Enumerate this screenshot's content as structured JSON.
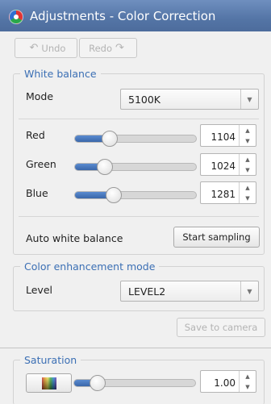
{
  "window": {
    "title": "Adjustments - Color Correction",
    "icon": "color-wheel-icon"
  },
  "toolbar": {
    "undo_label": "Undo",
    "undo_icon": "undo-arrow-icon",
    "redo_label": "Redo",
    "redo_icon": "redo-arrow-icon"
  },
  "white_balance": {
    "legend": "White balance",
    "mode_label": "Mode",
    "mode_value": "5100K",
    "red_label": "Red",
    "red_value": "1104",
    "red_fraction": 0.29,
    "green_label": "Green",
    "green_value": "1024",
    "green_fraction": 0.25,
    "blue_label": "Blue",
    "blue_value": "1281",
    "blue_fraction": 0.32,
    "auto_label": "Auto white balance",
    "start_sampling_label": "Start sampling"
  },
  "color_enhancement": {
    "legend": "Color enhancement mode",
    "level_label": "Level",
    "level_value": "LEVEL2"
  },
  "save_to_camera_label": "Save to camera",
  "saturation": {
    "legend": "Saturation",
    "value": "1.00",
    "fraction": 0.2,
    "swatch_icon": "color-spectrum-icon"
  }
}
